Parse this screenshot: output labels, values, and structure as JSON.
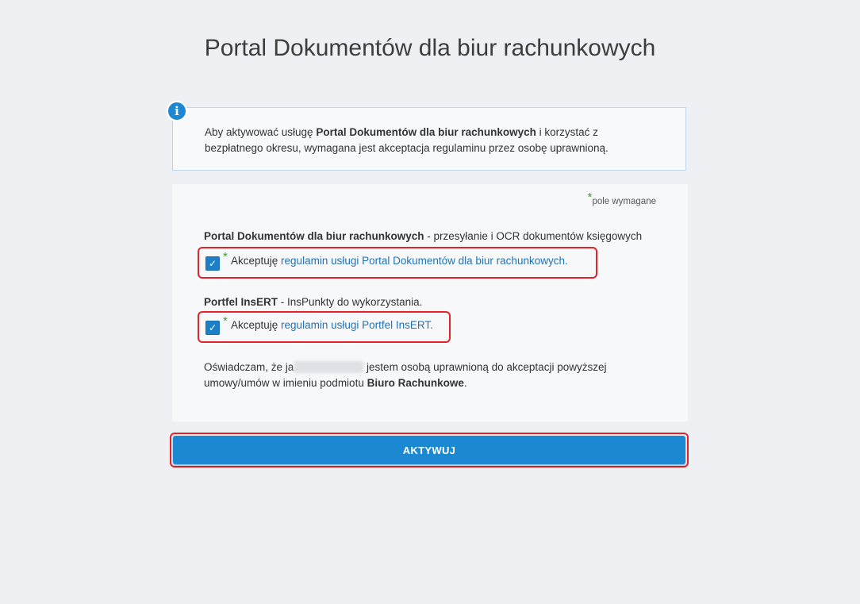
{
  "page": {
    "title": "Portal Dokumentów dla biur rachunkowych"
  },
  "info": {
    "icon": "info-icon",
    "icon_glyph": "i",
    "text_before": "Aby aktywować usługę ",
    "text_bold": "Portal Dokumentów dla biur rachunkowych",
    "text_after": " i korzystać z bezpłatnego okresu, wymagana jest akceptacja regulaminu przez osobę uprawnioną."
  },
  "form": {
    "required_asterisk": "*",
    "required_note": "pole wymagane",
    "services": [
      {
        "name": "Portal Dokumentów dla biur rachunkowych",
        "description": " - przesyłanie i OCR dokumentów księgowych",
        "checked": true,
        "accept_prefix": "Akceptuję ",
        "accept_link": "regulamin usługi Portal Dokumentów dla biur rachunkowych",
        "accept_suffix": "."
      },
      {
        "name": "Portfel InsERT",
        "description": " - InsPunkty do wykorzystania.",
        "checked": true,
        "accept_prefix": "Akceptuję ",
        "accept_link": "regulamin usługi Portfel InsERT",
        "accept_suffix": "."
      }
    ],
    "statement": {
      "part1": "Oświadczam, że ja",
      "part2": " jestem osobą uprawnioną do akceptacji powyższej umowy/umów w imieniu podmiotu ",
      "entity": "Biuro Rachunkowe",
      "part3": "."
    },
    "check_glyph": "✓"
  },
  "actions": {
    "activate_label": "AKTYWUJ"
  },
  "colors": {
    "accent": "#1c88d2",
    "link": "#1f73b7",
    "highlight_border": "#e0242a",
    "required": "#3aa03a"
  }
}
